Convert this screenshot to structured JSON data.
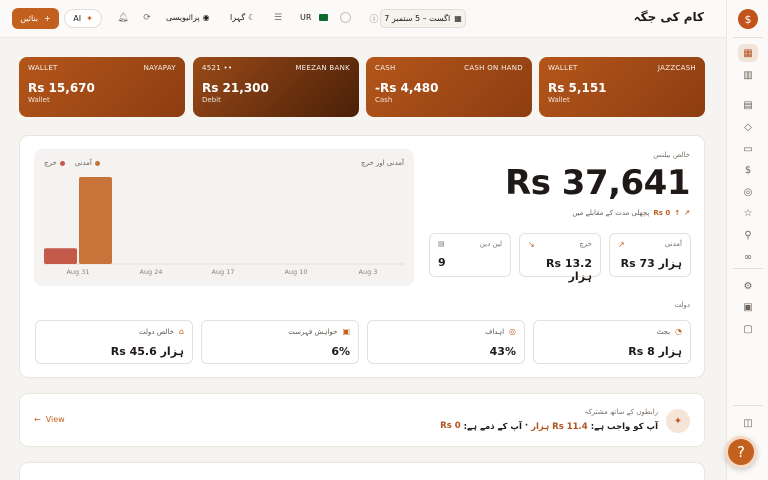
{
  "header": {
    "title": "کام کی جگہ",
    "date_range": "7 اگست – 5 ستمبر",
    "language": "UR",
    "privacy_label": "پرائیویسی",
    "theme_label": "گہرا",
    "ai_label": "AI",
    "create_label": "بنائیں"
  },
  "accounts": [
    {
      "type": "WALLET",
      "name": "JAZZCASH",
      "amount": "Rs 5,151",
      "sub": "Wallet"
    },
    {
      "type": "CASH",
      "name": "CASH ON HAND",
      "amount": "-Rs 4,480",
      "sub": "Cash"
    },
    {
      "type": "4521 ••",
      "name": "MEEZAN BANK",
      "amount": "Rs 21,300",
      "sub": "Debit"
    },
    {
      "type": "WALLET",
      "name": "NAYAPAY",
      "amount": "Rs 15,670",
      "sub": "Wallet"
    }
  ],
  "net_balance": {
    "label": "خالص بیلنس",
    "amount": "Rs 37,641",
    "change_value": "Rs 0",
    "change_text": "پچھلی مدت کے مقابلے میں"
  },
  "stats": [
    {
      "label": "آمدنی",
      "value": "Rs 73 ہزار",
      "icon": "trend-up-icon"
    },
    {
      "label": "خرچ",
      "value": "Rs 13.2 ہزار",
      "icon": "trend-down-icon"
    },
    {
      "label": "لین دین",
      "value": "9",
      "icon": "receipt-icon"
    }
  ],
  "chart_data": {
    "type": "bar",
    "title": "آمدنی اور خرچ",
    "categories": [
      "Aug 3",
      "Aug 10",
      "Aug 17",
      "Aug 24",
      "Aug 31"
    ],
    "series": [
      {
        "name": "آمدنی",
        "color": "#c8733a",
        "values": [
          0,
          0,
          0,
          0,
          73000
        ]
      },
      {
        "name": "خرچ",
        "color": "#c45a4a",
        "values": [
          0,
          0,
          0,
          0,
          13200
        ]
      }
    ],
    "ylim": [
      0,
      73000
    ]
  },
  "wealth": {
    "label": "دولت",
    "cards": [
      {
        "label": "بجٹ",
        "value": "Rs 8 ہزار",
        "icon": "budget-icon"
      },
      {
        "label": "اہداف",
        "value": "43%",
        "icon": "target-icon"
      },
      {
        "label": "خواہش فہرست",
        "value": "6%",
        "icon": "gift-icon"
      },
      {
        "label": "خالص دولت",
        "value": "Rs 45.6 ہزار",
        "icon": "bank-icon"
      }
    ]
  },
  "contacts": {
    "title": "رابطوں کے ساتھ مشترکہ",
    "owe_label": "آپ کو واجب ہے:",
    "owe_value": "Rs 11.4 ہزار",
    "sep": "·",
    "you_owe_label": "آپ کے ذمے ہے:",
    "you_owe_value": "Rs 0",
    "view_label": "View"
  },
  "colors": {
    "accent": "#c2611f",
    "accent_dark": "#8d3d12"
  }
}
